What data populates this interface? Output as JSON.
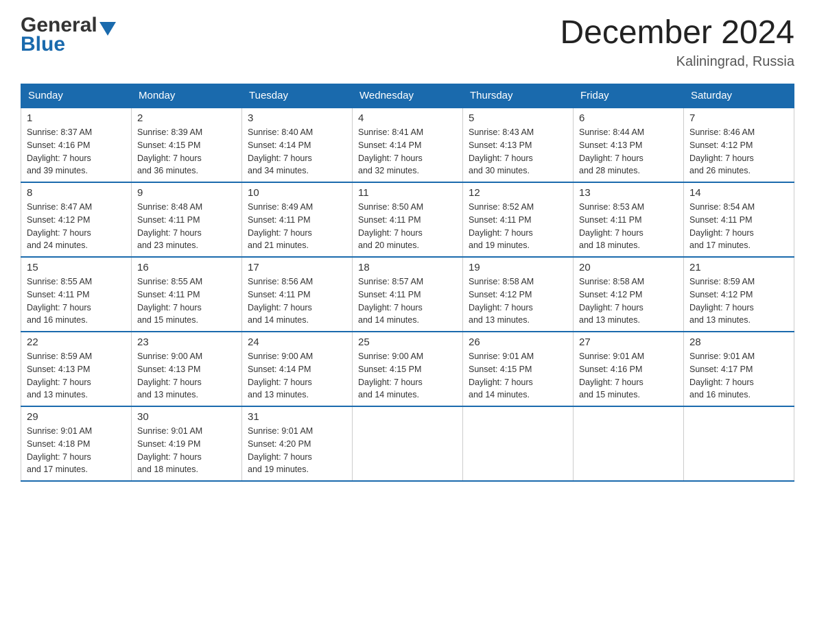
{
  "header": {
    "logo_general": "General",
    "logo_blue": "Blue",
    "title": "December 2024",
    "location": "Kaliningrad, Russia"
  },
  "days_of_week": [
    "Sunday",
    "Monday",
    "Tuesday",
    "Wednesday",
    "Thursday",
    "Friday",
    "Saturday"
  ],
  "weeks": [
    [
      {
        "day": "1",
        "sunrise": "Sunrise: 8:37 AM",
        "sunset": "Sunset: 4:16 PM",
        "daylight": "Daylight: 7 hours",
        "daylight2": "and 39 minutes."
      },
      {
        "day": "2",
        "sunrise": "Sunrise: 8:39 AM",
        "sunset": "Sunset: 4:15 PM",
        "daylight": "Daylight: 7 hours",
        "daylight2": "and 36 minutes."
      },
      {
        "day": "3",
        "sunrise": "Sunrise: 8:40 AM",
        "sunset": "Sunset: 4:14 PM",
        "daylight": "Daylight: 7 hours",
        "daylight2": "and 34 minutes."
      },
      {
        "day": "4",
        "sunrise": "Sunrise: 8:41 AM",
        "sunset": "Sunset: 4:14 PM",
        "daylight": "Daylight: 7 hours",
        "daylight2": "and 32 minutes."
      },
      {
        "day": "5",
        "sunrise": "Sunrise: 8:43 AM",
        "sunset": "Sunset: 4:13 PM",
        "daylight": "Daylight: 7 hours",
        "daylight2": "and 30 minutes."
      },
      {
        "day": "6",
        "sunrise": "Sunrise: 8:44 AM",
        "sunset": "Sunset: 4:13 PM",
        "daylight": "Daylight: 7 hours",
        "daylight2": "and 28 minutes."
      },
      {
        "day": "7",
        "sunrise": "Sunrise: 8:46 AM",
        "sunset": "Sunset: 4:12 PM",
        "daylight": "Daylight: 7 hours",
        "daylight2": "and 26 minutes."
      }
    ],
    [
      {
        "day": "8",
        "sunrise": "Sunrise: 8:47 AM",
        "sunset": "Sunset: 4:12 PM",
        "daylight": "Daylight: 7 hours",
        "daylight2": "and 24 minutes."
      },
      {
        "day": "9",
        "sunrise": "Sunrise: 8:48 AM",
        "sunset": "Sunset: 4:11 PM",
        "daylight": "Daylight: 7 hours",
        "daylight2": "and 23 minutes."
      },
      {
        "day": "10",
        "sunrise": "Sunrise: 8:49 AM",
        "sunset": "Sunset: 4:11 PM",
        "daylight": "Daylight: 7 hours",
        "daylight2": "and 21 minutes."
      },
      {
        "day": "11",
        "sunrise": "Sunrise: 8:50 AM",
        "sunset": "Sunset: 4:11 PM",
        "daylight": "Daylight: 7 hours",
        "daylight2": "and 20 minutes."
      },
      {
        "day": "12",
        "sunrise": "Sunrise: 8:52 AM",
        "sunset": "Sunset: 4:11 PM",
        "daylight": "Daylight: 7 hours",
        "daylight2": "and 19 minutes."
      },
      {
        "day": "13",
        "sunrise": "Sunrise: 8:53 AM",
        "sunset": "Sunset: 4:11 PM",
        "daylight": "Daylight: 7 hours",
        "daylight2": "and 18 minutes."
      },
      {
        "day": "14",
        "sunrise": "Sunrise: 8:54 AM",
        "sunset": "Sunset: 4:11 PM",
        "daylight": "Daylight: 7 hours",
        "daylight2": "and 17 minutes."
      }
    ],
    [
      {
        "day": "15",
        "sunrise": "Sunrise: 8:55 AM",
        "sunset": "Sunset: 4:11 PM",
        "daylight": "Daylight: 7 hours",
        "daylight2": "and 16 minutes."
      },
      {
        "day": "16",
        "sunrise": "Sunrise: 8:55 AM",
        "sunset": "Sunset: 4:11 PM",
        "daylight": "Daylight: 7 hours",
        "daylight2": "and 15 minutes."
      },
      {
        "day": "17",
        "sunrise": "Sunrise: 8:56 AM",
        "sunset": "Sunset: 4:11 PM",
        "daylight": "Daylight: 7 hours",
        "daylight2": "and 14 minutes."
      },
      {
        "day": "18",
        "sunrise": "Sunrise: 8:57 AM",
        "sunset": "Sunset: 4:11 PM",
        "daylight": "Daylight: 7 hours",
        "daylight2": "and 14 minutes."
      },
      {
        "day": "19",
        "sunrise": "Sunrise: 8:58 AM",
        "sunset": "Sunset: 4:12 PM",
        "daylight": "Daylight: 7 hours",
        "daylight2": "and 13 minutes."
      },
      {
        "day": "20",
        "sunrise": "Sunrise: 8:58 AM",
        "sunset": "Sunset: 4:12 PM",
        "daylight": "Daylight: 7 hours",
        "daylight2": "and 13 minutes."
      },
      {
        "day": "21",
        "sunrise": "Sunrise: 8:59 AM",
        "sunset": "Sunset: 4:12 PM",
        "daylight": "Daylight: 7 hours",
        "daylight2": "and 13 minutes."
      }
    ],
    [
      {
        "day": "22",
        "sunrise": "Sunrise: 8:59 AM",
        "sunset": "Sunset: 4:13 PM",
        "daylight": "Daylight: 7 hours",
        "daylight2": "and 13 minutes."
      },
      {
        "day": "23",
        "sunrise": "Sunrise: 9:00 AM",
        "sunset": "Sunset: 4:13 PM",
        "daylight": "Daylight: 7 hours",
        "daylight2": "and 13 minutes."
      },
      {
        "day": "24",
        "sunrise": "Sunrise: 9:00 AM",
        "sunset": "Sunset: 4:14 PM",
        "daylight": "Daylight: 7 hours",
        "daylight2": "and 13 minutes."
      },
      {
        "day": "25",
        "sunrise": "Sunrise: 9:00 AM",
        "sunset": "Sunset: 4:15 PM",
        "daylight": "Daylight: 7 hours",
        "daylight2": "and 14 minutes."
      },
      {
        "day": "26",
        "sunrise": "Sunrise: 9:01 AM",
        "sunset": "Sunset: 4:15 PM",
        "daylight": "Daylight: 7 hours",
        "daylight2": "and 14 minutes."
      },
      {
        "day": "27",
        "sunrise": "Sunrise: 9:01 AM",
        "sunset": "Sunset: 4:16 PM",
        "daylight": "Daylight: 7 hours",
        "daylight2": "and 15 minutes."
      },
      {
        "day": "28",
        "sunrise": "Sunrise: 9:01 AM",
        "sunset": "Sunset: 4:17 PM",
        "daylight": "Daylight: 7 hours",
        "daylight2": "and 16 minutes."
      }
    ],
    [
      {
        "day": "29",
        "sunrise": "Sunrise: 9:01 AM",
        "sunset": "Sunset: 4:18 PM",
        "daylight": "Daylight: 7 hours",
        "daylight2": "and 17 minutes."
      },
      {
        "day": "30",
        "sunrise": "Sunrise: 9:01 AM",
        "sunset": "Sunset: 4:19 PM",
        "daylight": "Daylight: 7 hours",
        "daylight2": "and 18 minutes."
      },
      {
        "day": "31",
        "sunrise": "Sunrise: 9:01 AM",
        "sunset": "Sunset: 4:20 PM",
        "daylight": "Daylight: 7 hours",
        "daylight2": "and 19 minutes."
      },
      null,
      null,
      null,
      null
    ]
  ]
}
